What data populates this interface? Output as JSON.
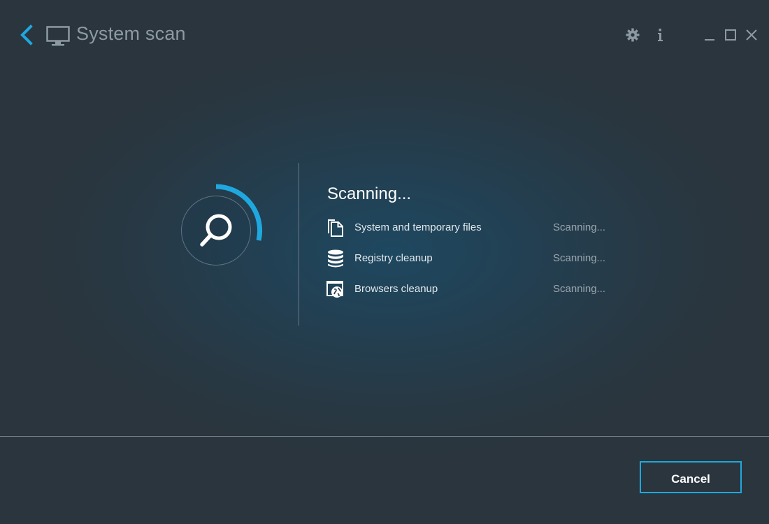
{
  "window": {
    "title": "System scan",
    "accent_color": "#1fa8df",
    "controls": [
      "gear-icon",
      "info-icon",
      "minimize-icon",
      "maximize-icon",
      "close-icon"
    ]
  },
  "scan": {
    "heading": "Scanning...",
    "items": [
      {
        "icon": "files-icon",
        "label": "System and temporary files",
        "status": "Scanning..."
      },
      {
        "icon": "database-icon",
        "label": "Registry cleanup",
        "status": "Scanning..."
      },
      {
        "icon": "browser-globe-icon",
        "label": "Browsers cleanup",
        "status": "Scanning..."
      }
    ],
    "spinner_icon": "magnifier-icon"
  },
  "footer": {
    "cancel_label": "Cancel"
  }
}
